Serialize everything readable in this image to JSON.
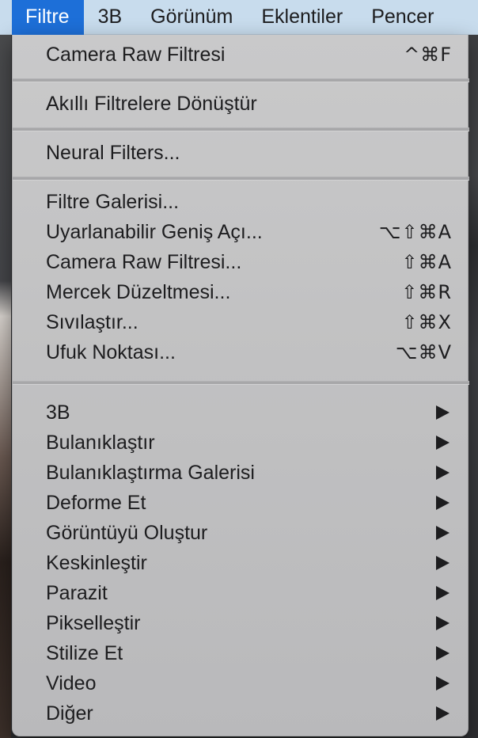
{
  "menubar": {
    "items": [
      {
        "label": "Filtre"
      },
      {
        "label": "3B"
      },
      {
        "label": "Görünüm"
      },
      {
        "label": "Eklentiler"
      },
      {
        "label": "Pencer"
      }
    ]
  },
  "menu": {
    "sections": [
      {
        "items": [
          {
            "label": "Camera Raw Filtresi",
            "shortcut": "^⌘F"
          }
        ]
      },
      {
        "items": [
          {
            "label": "Akıllı Filtrelere Dönüştür"
          }
        ]
      },
      {
        "items": [
          {
            "label": "Neural Filters..."
          }
        ]
      },
      {
        "items": [
          {
            "label": "Filtre Galerisi..."
          },
          {
            "label": "Uyarlanabilir Geniş Açı...",
            "shortcut": "⌥⇧⌘A"
          },
          {
            "label": "Camera Raw Filtresi...",
            "shortcut": "⇧⌘A"
          },
          {
            "label": "Mercek Düzeltmesi...",
            "shortcut": "⇧⌘R"
          },
          {
            "label": "Sıvılaştır...",
            "shortcut": "⇧⌘X"
          },
          {
            "label": "Ufuk Noktası...",
            "shortcut": "⌥⌘V"
          }
        ]
      },
      {
        "items": [
          {
            "label": "3B",
            "submenu": true
          },
          {
            "label": "Bulanıklaştır",
            "submenu": true
          },
          {
            "label": "Bulanıklaştırma Galerisi",
            "submenu": true
          },
          {
            "label": "Deforme Et",
            "submenu": true
          },
          {
            "label": "Görüntüyü Oluştur",
            "submenu": true
          },
          {
            "label": "Keskinleştir",
            "submenu": true
          },
          {
            "label": "Parazit",
            "submenu": true
          },
          {
            "label": "Pikselleştir",
            "submenu": true
          },
          {
            "label": "Stilize Et",
            "submenu": true
          },
          {
            "label": "Video",
            "submenu": true
          },
          {
            "label": "Diğer",
            "submenu": true
          }
        ]
      }
    ]
  },
  "colors": {
    "menubar_bg": "#c8dced",
    "active_menu_bg": "#1d6fd8",
    "menu_bg": "#c2c2c3",
    "text": "#1d1d1f"
  }
}
